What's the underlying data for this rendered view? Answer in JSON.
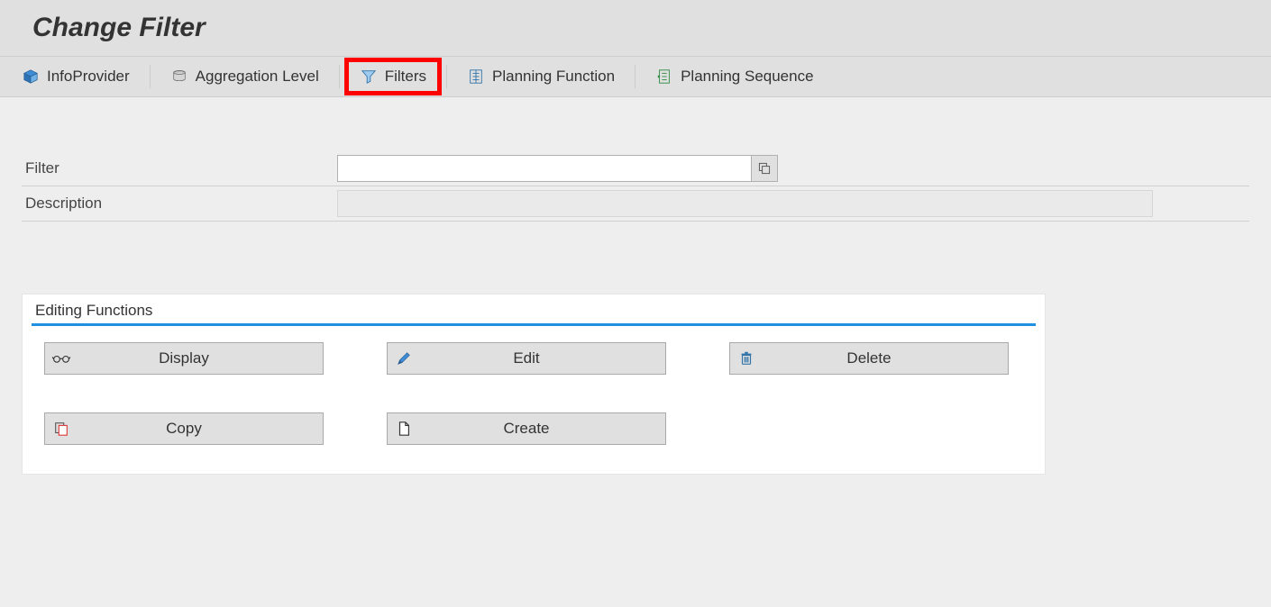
{
  "header": {
    "title": "Change Filter"
  },
  "toolbar": {
    "items": [
      {
        "label": "InfoProvider"
      },
      {
        "label": "Aggregation Level"
      },
      {
        "label": "Filters"
      },
      {
        "label": "Planning Function"
      },
      {
        "label": "Planning Sequence"
      }
    ]
  },
  "fields": {
    "filter_label": "Filter",
    "filter_value": "",
    "description_label": "Description",
    "description_value": ""
  },
  "group": {
    "title": "Editing Functions",
    "buttons": {
      "display": "Display",
      "edit": "Edit",
      "delete": "Delete",
      "copy": "Copy",
      "create": "Create"
    }
  },
  "colors": {
    "highlight": "#ff0000",
    "accent": "#1f8fe0"
  }
}
